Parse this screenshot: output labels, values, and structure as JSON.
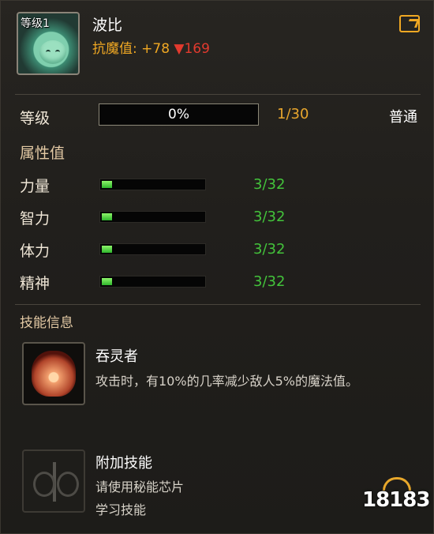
{
  "pet": {
    "level_badge": "等级1",
    "name": "波比",
    "resist_label": "抗魔值: +78",
    "resist_down": "▼169"
  },
  "level": {
    "label": "等级",
    "progress_text": "0%",
    "progress": 0,
    "count": "1/30",
    "rank": "普通"
  },
  "attributes": {
    "title": "属性值",
    "items": [
      {
        "label": "力量",
        "value": "3/32",
        "fraction": 0.094
      },
      {
        "label": "智力",
        "value": "3/32",
        "fraction": 0.094
      },
      {
        "label": "体力",
        "value": "3/32",
        "fraction": 0.094
      },
      {
        "label": "精神",
        "value": "3/32",
        "fraction": 0.094
      }
    ]
  },
  "skills": {
    "title": "技能信息",
    "main": {
      "name": "吞灵者",
      "desc": "攻击时，有10%的几率减少敌人5%的魔法值。"
    },
    "extra": {
      "name": "附加技能",
      "line1": "请使用秘能芯片",
      "line2": "学习技能"
    }
  },
  "watermark": "18183",
  "colors": {
    "gold": "#f0a823",
    "red": "#e23a2e",
    "green": "#43c33b"
  }
}
